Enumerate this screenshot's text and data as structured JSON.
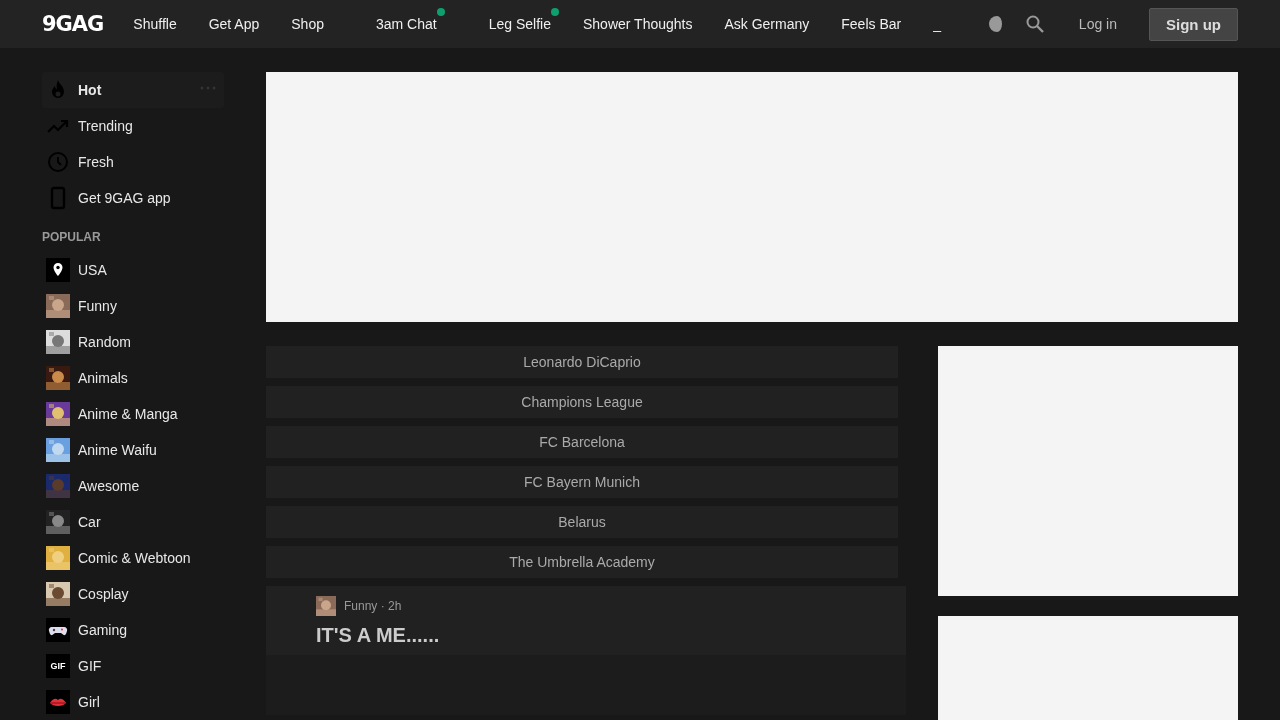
{
  "header": {
    "logo": "9GAG",
    "nav": [
      {
        "label": "Shuffle",
        "dot": false
      },
      {
        "label": "Get App",
        "dot": false
      },
      {
        "label": "Shop",
        "dot": false
      },
      {
        "label": "3am Chat",
        "dot": true
      },
      {
        "label": "Leg Selfie",
        "dot": true
      },
      {
        "label": "Shower Thoughts",
        "dot": false
      },
      {
        "label": "Ask Germany",
        "dot": false
      },
      {
        "label": "Feels Bar",
        "dot": false
      },
      {
        "label": "_",
        "dot": false
      }
    ],
    "login": "Log in",
    "signup": "Sign up"
  },
  "sidebar": {
    "items": [
      {
        "label": "Hot",
        "selected": true,
        "kind": "hot"
      },
      {
        "label": "Trending",
        "selected": false,
        "kind": "trending"
      },
      {
        "label": "Fresh",
        "selected": false,
        "kind": "fresh"
      },
      {
        "label": "Get 9GAG app",
        "selected": false,
        "kind": "app"
      }
    ],
    "section_title": "POPULAR",
    "popular": [
      {
        "label": "USA",
        "kind": "icon"
      },
      {
        "label": "Funny",
        "kind": "picture"
      },
      {
        "label": "Random",
        "kind": "picture"
      },
      {
        "label": "Animals",
        "kind": "picture"
      },
      {
        "label": "Anime & Manga",
        "kind": "picture"
      },
      {
        "label": "Anime Waifu",
        "kind": "picture"
      },
      {
        "label": "Awesome",
        "kind": "picture"
      },
      {
        "label": "Car",
        "kind": "picture"
      },
      {
        "label": "Comic & Webtoon",
        "kind": "picture"
      },
      {
        "label": "Cosplay",
        "kind": "picture"
      },
      {
        "label": "Gaming",
        "kind": "icon"
      },
      {
        "label": "GIF",
        "kind": "badge",
        "badge": "GIF"
      },
      {
        "label": "Girl",
        "kind": "icon"
      }
    ]
  },
  "tags": [
    "Leonardo DiCaprio",
    "Champions League",
    "FC Barcelona",
    "FC Bayern Munich",
    "Belarus",
    "The Umbrella Academy"
  ],
  "post": {
    "meta": "Funny · 2h",
    "title": "IT'S A ME......"
  }
}
